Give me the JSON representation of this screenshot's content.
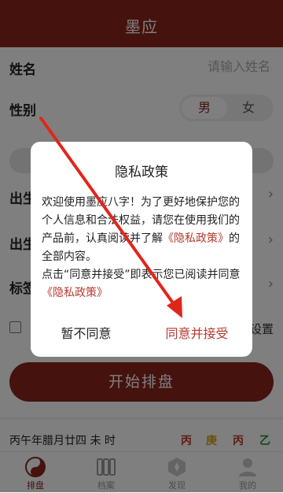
{
  "header": {
    "title": "墨应"
  },
  "form": {
    "name_label": "姓名",
    "name_placeholder": "请输入姓名",
    "gender_label": "性别",
    "gender_male": "男",
    "gender_female": "女",
    "partial_labels": [
      "出生",
      "出生",
      "标签"
    ],
    "settings_text": "设置",
    "start_button": "开始排盘"
  },
  "lunar_bar": {
    "date": "丙午年腊月廿四 未 时",
    "pillars": [
      {
        "char": "丙",
        "color": "#c0392b"
      },
      {
        "char": "庚",
        "color": "#d4a017"
      },
      {
        "char": "丙",
        "color": "#c0392b"
      },
      {
        "char": "乙",
        "color": "#2e8b3e"
      }
    ]
  },
  "tabs": [
    {
      "label": "排盘",
      "icon": "yin-yang-icon",
      "active": true
    },
    {
      "label": "档案",
      "icon": "archive-icon",
      "active": false
    },
    {
      "label": "发现",
      "icon": "compass-icon",
      "active": false
    },
    {
      "label": "我的",
      "icon": "user-icon",
      "active": false
    }
  ],
  "dialog": {
    "title": "隐私政策",
    "body_1": "欢迎使用墨应八字！为了更好地保护您的个人信息和合法权益，请您在使用我们的产品前，认真阅读并了解",
    "link_1": "《隐私政策》",
    "body_2": "的全部内容。",
    "body_3": "点击“同意并接受”即表示您已阅读并同意",
    "link_2": "《隐私政策》",
    "disagree_button": "暂不同意",
    "agree_button": "同意并接受"
  },
  "colors": {
    "brand": "#8b241c",
    "accent": "#b53a30",
    "annotation_arrow": "#e0261b"
  }
}
